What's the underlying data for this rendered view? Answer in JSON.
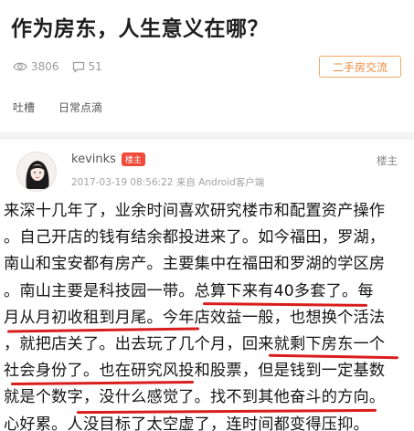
{
  "post": {
    "title": "作为房东，人生意义在哪？",
    "views": "3806",
    "comments": "51",
    "category": "二手房交流",
    "tags": [
      "吐槽",
      "日常点滴"
    ]
  },
  "reply": {
    "username": "kevinks",
    "badge": "楼主",
    "meta": "2017-03-19 08:56:22   来自 Android客户端",
    "floor": "楼主",
    "lines": [
      "来深十几年了，业余时间喜欢研究楼市和配置资产操作",
      "。自己开店的钱有结余都投进来了。如今福田，罗湖，",
      "南山和宝安都有房产。主要集中在福田和罗湖的学区房",
      "。南山主要是科技园一带。总算下来有40多套了。每",
      "月从月初收租到月尾。今年店效益一般，也想换个活法",
      "，就把店关了。出去玩了几个月，回来就剩下房东一个",
      "社会身份了。也在研究风投和股票，但是钱到一定基数",
      "就是个数字，没什么感觉了。找不到其他奋斗的方向。",
      "心好累。人没目标了太空虚了，连时间都变得压抑。"
    ]
  },
  "colors": {
    "accent": "#ef8a3c",
    "badge": "#f04a3b",
    "underline": "#d91d1d"
  }
}
